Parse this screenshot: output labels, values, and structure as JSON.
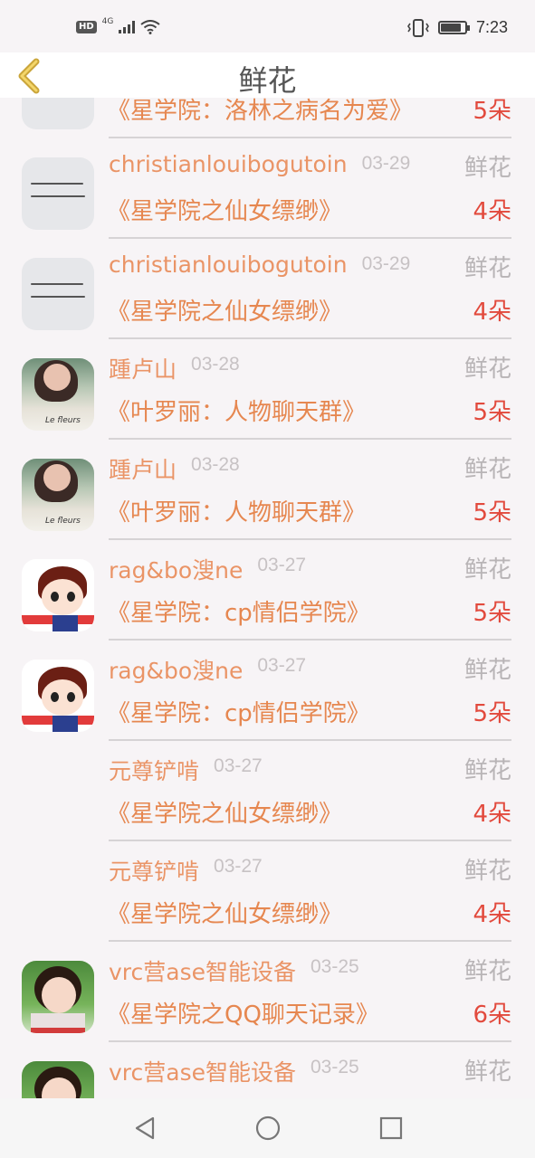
{
  "status": {
    "network": "4G",
    "hd": "HD",
    "time": "7:23",
    "battery_level": 0.85
  },
  "header": {
    "title": "鲜花"
  },
  "rows": [
    {
      "name": "",
      "date": "",
      "type": "",
      "book": "《星学院：洛林之病名为爱》",
      "count": "5朵",
      "avatar": "calligraphy"
    },
    {
      "name": "christianlouibogutoin",
      "date": "03-29",
      "type": "鲜花",
      "book": "《星学院之仙女缥缈》",
      "count": "4朵",
      "avatar": "calligraphy"
    },
    {
      "name": "christianlouibogutoin",
      "date": "03-29",
      "type": "鲜花",
      "book": "《星学院之仙女缥缈》",
      "count": "4朵",
      "avatar": "calligraphy"
    },
    {
      "name": "踵卢山",
      "date": "03-28",
      "type": "鲜花",
      "book": "《叶罗丽：人物聊天群》",
      "count": "5朵",
      "avatar": "photo-woman"
    },
    {
      "name": "踵卢山",
      "date": "03-28",
      "type": "鲜花",
      "book": "《叶罗丽：人物聊天群》",
      "count": "5朵",
      "avatar": "photo-woman"
    },
    {
      "name": "rag&bo溲ne",
      "date": "03-27",
      "type": "鲜花",
      "book": "《星学院：cp情侣学院》",
      "count": "5朵",
      "avatar": "cartoon"
    },
    {
      "name": "rag&bo溲ne",
      "date": "03-27",
      "type": "鲜花",
      "book": "《星学院：cp情侣学院》",
      "count": "5朵",
      "avatar": "cartoon"
    },
    {
      "name": "元尊铲啃",
      "date": "03-27",
      "type": "鲜花",
      "book": "《星学院之仙女缥缈》",
      "count": "4朵",
      "avatar": "blank"
    },
    {
      "name": "元尊铲啃",
      "date": "03-27",
      "type": "鲜花",
      "book": "《星学院之仙女缥缈》",
      "count": "4朵",
      "avatar": "blank"
    },
    {
      "name": "vrc营ase智能设备",
      "date": "03-25",
      "type": "鲜花",
      "book": "《星学院之QQ聊天记录》",
      "count": "6朵",
      "avatar": "girl"
    },
    {
      "name": "vrc营ase智能设备",
      "date": "03-25",
      "type": "鲜花",
      "book": "",
      "count": "",
      "avatar": "girl"
    }
  ],
  "colors": {
    "name": "#ea9466",
    "book": "#e68750",
    "count": "#e24a3d",
    "type": "#b8b4b6",
    "date": "#c7c2c4"
  },
  "icons": {
    "back": "chevron-left-icon",
    "nav_back": "triangle-back-icon",
    "nav_home": "circle-home-icon",
    "nav_recent": "square-recent-icon"
  }
}
